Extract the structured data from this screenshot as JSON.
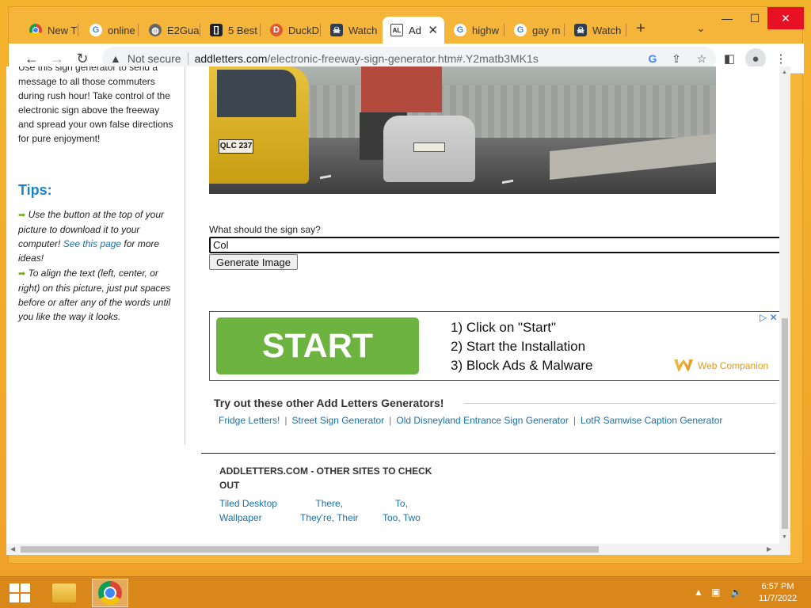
{
  "browser": {
    "tabs": [
      {
        "label": "New T",
        "icon": "chrome-icon"
      },
      {
        "label": "online",
        "icon": "google-icon"
      },
      {
        "label": "E2Gua",
        "icon": "globe-icon"
      },
      {
        "label": "5 Best",
        "icon": "bracket-icon"
      },
      {
        "label": "DuckD",
        "icon": "duckduckgo-icon"
      },
      {
        "label": "Watch",
        "icon": "skull-icon"
      },
      {
        "label": "Ad",
        "icon": "addletters-icon",
        "active": true
      },
      {
        "label": "highw",
        "icon": "google-icon"
      },
      {
        "label": "gay m",
        "icon": "google-icon"
      },
      {
        "label": "Watch",
        "icon": "skull-icon"
      }
    ],
    "security_label": "Not secure",
    "url_domain": "addletters.com",
    "url_path": "/electronic-freeway-sign-generator.htm#.Y2matb3MK1s"
  },
  "sidebar": {
    "intro_lines": [
      "Use this sign generator to send a",
      "message to all those commuters",
      "during rush hour! Take control of the",
      "electronic sign above the freeway",
      "and spread your own false directions",
      "for pure enjoyment!"
    ],
    "tips_heading": "Tips:",
    "tip1_pre": "Use the button at the top of your picture to download it to your computer! ",
    "tip1_link": "See this page",
    "tip1_post": " for more ideas!",
    "tip2": "To align the text (left, center, or right) on this picture, just put spaces before or after any of the words until you like the way it looks."
  },
  "main": {
    "photo_plate": "QLC 237",
    "sign_question": "What should the sign say?",
    "sign_value": "Col",
    "generate_label": "Generate Image"
  },
  "ad": {
    "start_label": "START",
    "steps": [
      "1) Click on \"Start\"",
      "2) Start the Installation",
      "3) Block Ads & Malware"
    ],
    "brand": "Web Companion"
  },
  "generators": {
    "heading": "Try out these other Add Letters Generators!",
    "links": [
      "Fridge Letters!",
      "Street Sign Generator",
      "Old Disneyland Entrance Sign Generator",
      "LotR Samwise Caption Generator"
    ]
  },
  "footer": {
    "heading": "ADDLETTERS.COM - OTHER SITES TO CHECK OUT",
    "links": [
      [
        "Tiled Desktop",
        "Wallpaper"
      ],
      [
        "There,",
        "They're, Their"
      ],
      [
        "To,",
        "Too, Two"
      ]
    ]
  },
  "taskbar": {
    "time": "6:57 PM",
    "date": "11/7/2022"
  }
}
